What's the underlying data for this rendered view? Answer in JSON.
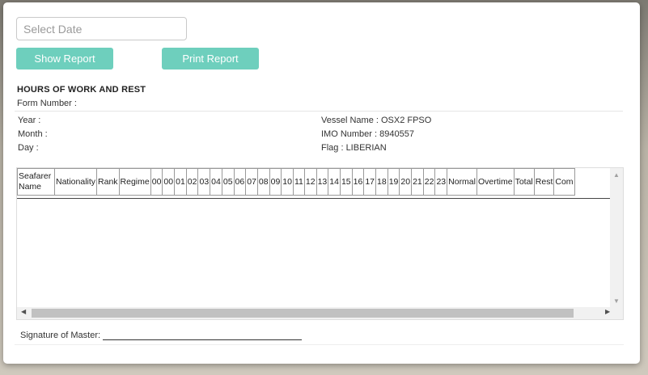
{
  "date_field": {
    "placeholder": "Select Date"
  },
  "buttons": {
    "show_report": "Show Report",
    "print_report": "Print Report"
  },
  "report": {
    "title": "HOURS OF WORK AND REST",
    "form_number": "Form Number :",
    "year": "Year :",
    "month": "Month :",
    "day": "Day :",
    "vessel_name": "Vessel Name : OSX2 FPSO",
    "imo_number": "IMO Number : 8940557",
    "flag": "Flag : LIBERIAN"
  },
  "table": {
    "columns": [
      "Seafarer Name",
      "Nationality",
      "Rank",
      "Regime",
      "00",
      "00",
      "01",
      "02",
      "03",
      "04",
      "05",
      "06",
      "07",
      "08",
      "09",
      "10",
      "11",
      "12",
      "13",
      "14",
      "15",
      "16",
      "17",
      "18",
      "19",
      "20",
      "21",
      "22",
      "23",
      "Normal",
      "Overtime",
      "Total",
      "Rest",
      "Com"
    ]
  },
  "signature": {
    "label": "Signature of Master:"
  }
}
